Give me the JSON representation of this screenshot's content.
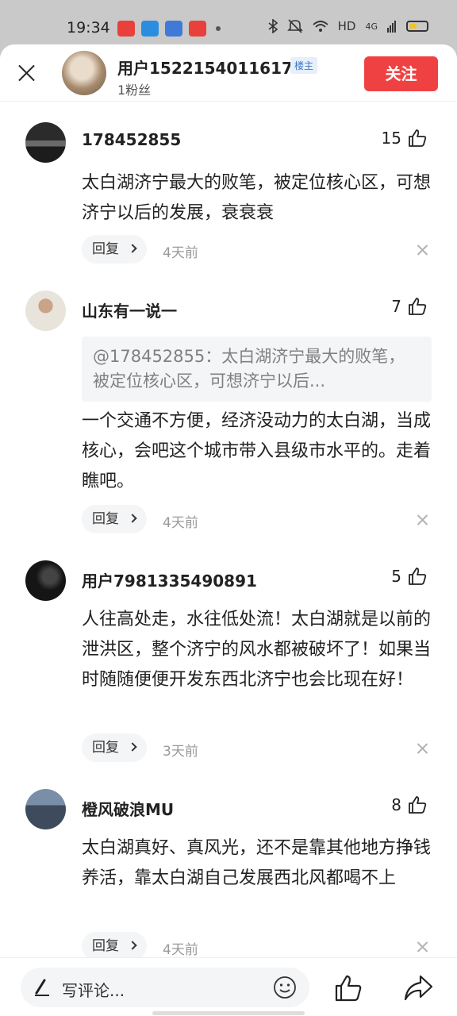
{
  "status_bar": {
    "time": "19:34",
    "network": "HD",
    "signal": "4G",
    "app_icon_colors": [
      "#e8413b",
      "#2b8de0",
      "#3f7ad8",
      "#e8413b"
    ]
  },
  "header": {
    "username": "用户1522154011617",
    "badge": "楼主",
    "fans": "1粉丝",
    "follow_label": "关注"
  },
  "comments": [
    {
      "username": "178452855",
      "likes": "15",
      "quote": "",
      "text": "太白湖济宁最大的败笔，被定位核心区，可想济宁以后的发展，衰衰衰",
      "reply_label": "回复",
      "time": "4天前"
    },
    {
      "username": "山东有一说一",
      "likes": "7",
      "quote": "@178452855：太白湖济宁最大的败笔，被定位核心区，可想济宁以后...",
      "text": "一个交通不方便，经济没动力的太白湖，当成核心，会吧这个城市带入县级市水平的。走着瞧吧。",
      "reply_label": "回复",
      "time": "4天前"
    },
    {
      "username": "用户7981335490891",
      "likes": "5",
      "quote": "",
      "text": "人往高处走，水往低处流！太白湖就是以前的泄洪区，整个济宁的风水都被破坏了！如果当时随随便便开发东西北济宁也会比现在好！",
      "reply_label": "回复",
      "time": "3天前"
    },
    {
      "username": "橙风破浪MU",
      "likes": "8",
      "quote": "",
      "text": "太白湖真好、真风光，还不是靠其他地方挣钱养活，靠太白湖自己发展西北风都喝不上",
      "reply_label": "回复",
      "time": "4天前"
    }
  ],
  "bottom_bar": {
    "placeholder": "写评论..."
  }
}
